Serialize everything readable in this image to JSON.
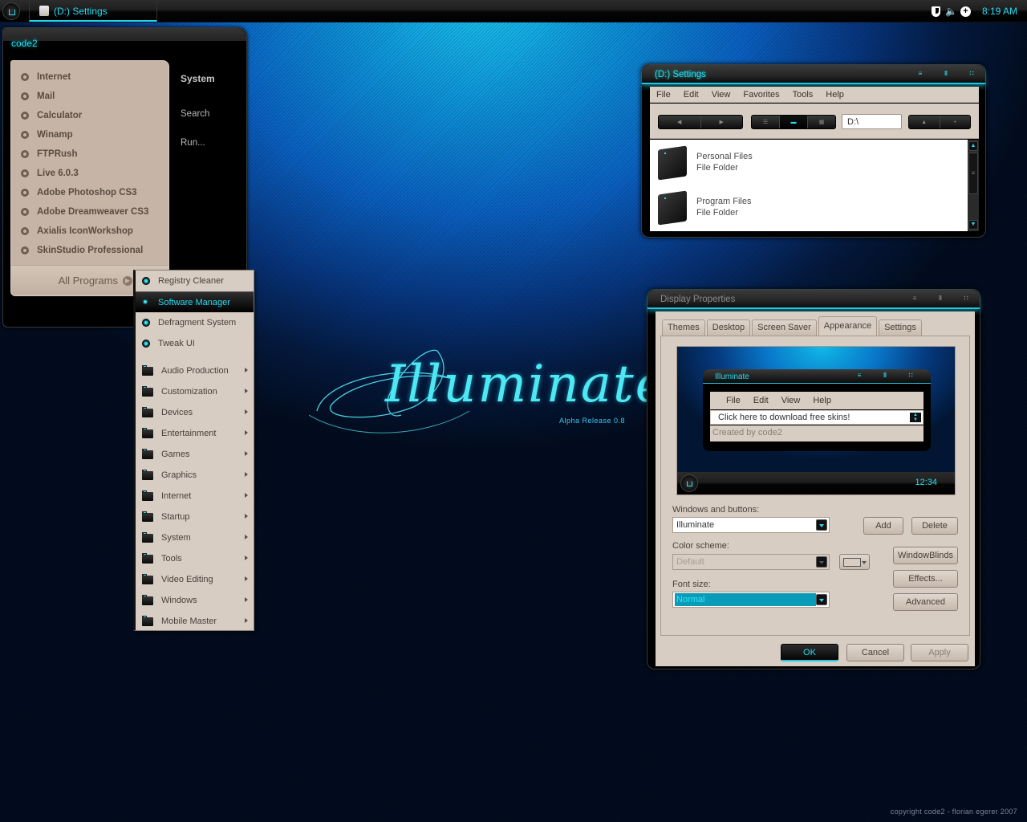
{
  "taskbar": {
    "start_icon": "start-orb-icon",
    "active_task": "(D:) Settings",
    "tray_icons": [
      "shield-icon",
      "volume-icon",
      "add-circle-icon"
    ],
    "clock": "8:19 AM"
  },
  "start_menu": {
    "user_name": "code2",
    "programs": [
      "Internet",
      "Mail",
      "Calculator",
      "Winamp",
      "FTPRush",
      "Live 6.0.3",
      "Adobe Photoshop CS3",
      "Adobe Dreamweaver CS3",
      "Axialis IconWorkshop",
      "SkinStudio Professional"
    ],
    "all_programs_label": "All Programs",
    "right_column": {
      "system": "System",
      "search": "Search",
      "run": "Run..."
    }
  },
  "submenu": {
    "shortcuts": [
      "Registry Cleaner",
      "Software Manager",
      "Defragment System",
      "Tweak UI"
    ],
    "active_shortcut": "Software Manager",
    "folders": [
      "Audio Production",
      "Customization",
      "Devices",
      "Entertainment",
      "Games",
      "Graphics",
      "Internet",
      "Startup",
      "System",
      "Tools",
      "Video Editing",
      "Windows",
      "Mobile Master"
    ]
  },
  "logo": {
    "title": "Illuminate",
    "subtitle": "Alpha Release 0.8"
  },
  "explorer": {
    "title": "(D:) Settings",
    "menu": [
      "File",
      "Edit",
      "View",
      "Favorites",
      "Tools",
      "Help"
    ],
    "address": "D:\\",
    "files": [
      {
        "name": "Personal Files",
        "type": "File Folder"
      },
      {
        "name": "Program Files",
        "type": "File Folder"
      }
    ]
  },
  "display_properties": {
    "title": "Display Properties",
    "tabs": [
      "Themes",
      "Desktop",
      "Screen Saver",
      "Appearance",
      "Settings"
    ],
    "active_tab": "Appearance",
    "preview": {
      "window_title": "Illuminate",
      "menu": [
        "File",
        "Edit",
        "View",
        "Help"
      ],
      "input_text": "Click here to download free skins!",
      "status_text": "Created by code2",
      "clock": "12:34"
    },
    "windows_and_buttons_label": "Windows and buttons:",
    "windows_and_buttons_value": "Illuminate",
    "color_scheme_label": "Color scheme:",
    "color_scheme_value": "Default",
    "font_size_label": "Font size:",
    "font_size_value": "Normal",
    "buttons": {
      "add": "Add",
      "delete": "Delete",
      "windowblinds": "WindowBlinds",
      "effects": "Effects...",
      "advanced": "Advanced",
      "ok": "OK",
      "cancel": "Cancel",
      "apply": "Apply"
    }
  },
  "copyright": "copyright code2 - florian egerer 2007",
  "colors": {
    "accent": "#27dcf3",
    "panel": "#d7cdc3",
    "start_panel": "#c6b5a6",
    "chrome": "#000000"
  }
}
